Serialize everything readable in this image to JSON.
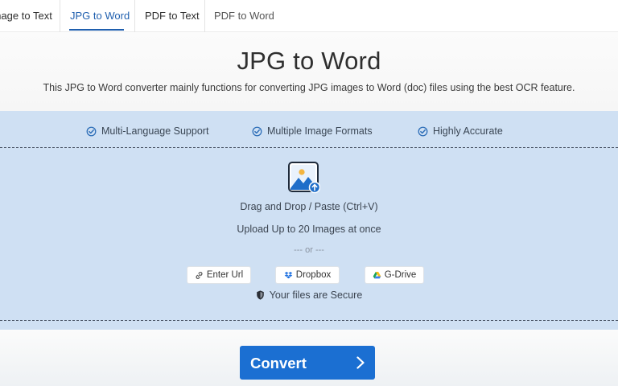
{
  "tabs": [
    {
      "label": "Image to Text",
      "active": false
    },
    {
      "label": "JPG to Word",
      "active": true
    },
    {
      "label": "PDF to Text",
      "active": false
    },
    {
      "label": "PDF to Word",
      "active": false
    }
  ],
  "header": {
    "title": "JPG to Word",
    "subtitle": "This JPG to Word converter mainly functions for converting JPG images to Word (doc) files using the best OCR feature."
  },
  "features": [
    {
      "label": "Multi-Language Support",
      "icon": "check-badge-icon"
    },
    {
      "label": "Multiple Image Formats",
      "icon": "check-badge-icon"
    },
    {
      "label": "Highly Accurate",
      "icon": "check-badge-icon"
    }
  ],
  "upload": {
    "icon": "image-upload-icon",
    "drag_text": "Drag and Drop / Paste (Ctrl+V)",
    "limit_text": "Upload Up to 20 Images at once",
    "or_text": "--- or ---",
    "sources": [
      {
        "label": "Enter Url",
        "icon": "link-icon"
      },
      {
        "label": "Dropbox",
        "icon": "dropbox-icon"
      },
      {
        "label": "G-Drive",
        "icon": "google-drive-icon"
      }
    ],
    "secure_text": "Your files are Secure"
  },
  "convert": {
    "label": "Convert",
    "icon": "chevron-right-icon"
  },
  "colors": {
    "accent": "#1b6fd2",
    "tab_active": "#1f5fae",
    "panel_bg": "#cfe0f3",
    "check": "#2f6fb8"
  }
}
